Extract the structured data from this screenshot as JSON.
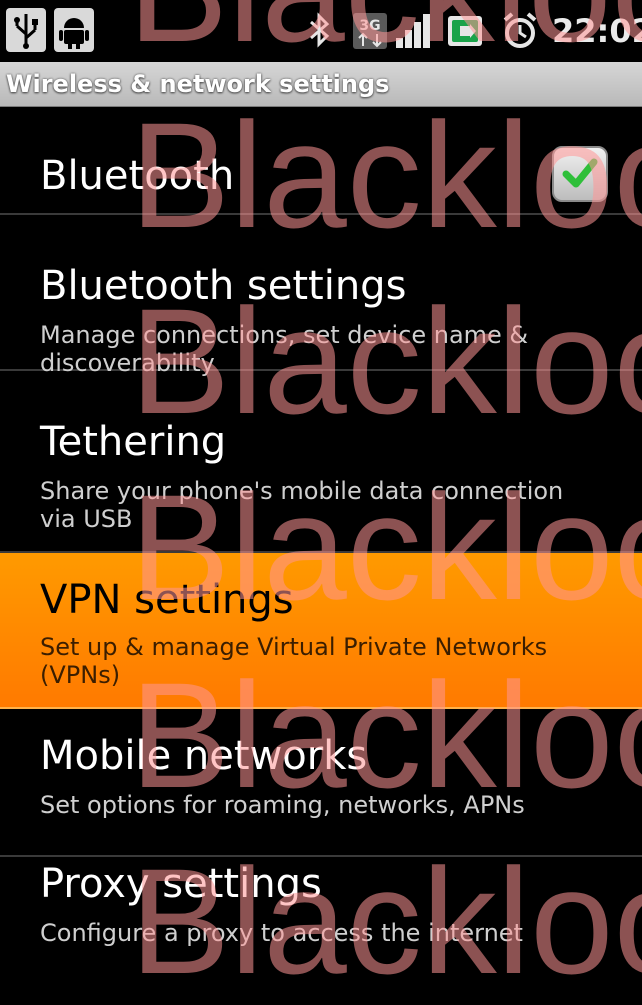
{
  "status_bar": {
    "time": "22:02",
    "icons": [
      "usb-icon",
      "android-debug-icon",
      "bluetooth-icon",
      "3g-data-icon",
      "signal-icon",
      "battery-icon",
      "alarm-icon"
    ],
    "network_label": "3G"
  },
  "header": {
    "title": "Wireless & network settings"
  },
  "items": [
    {
      "title": "Bluetooth",
      "summary": "",
      "checked": true
    },
    {
      "title": "Bluetooth settings",
      "summary": "Manage connections, set device name & discoverability"
    },
    {
      "title": "Tethering",
      "summary": "Share your phone's mobile data connection via USB"
    },
    {
      "title": "VPN settings",
      "summary": "Set up & manage Virtual Private Networks (VPNs)",
      "selected": true
    },
    {
      "title": "Mobile networks",
      "summary": "Set options for roaming, networks, APNs"
    },
    {
      "title": "Proxy settings",
      "summary": "Configure a proxy to access the internet"
    }
  ],
  "watermark": {
    "text": "Blackloo"
  },
  "colors": {
    "selection": "#ff8a00",
    "background": "#000000",
    "header": "#c8c8c8",
    "check": "#2fbf3a"
  }
}
